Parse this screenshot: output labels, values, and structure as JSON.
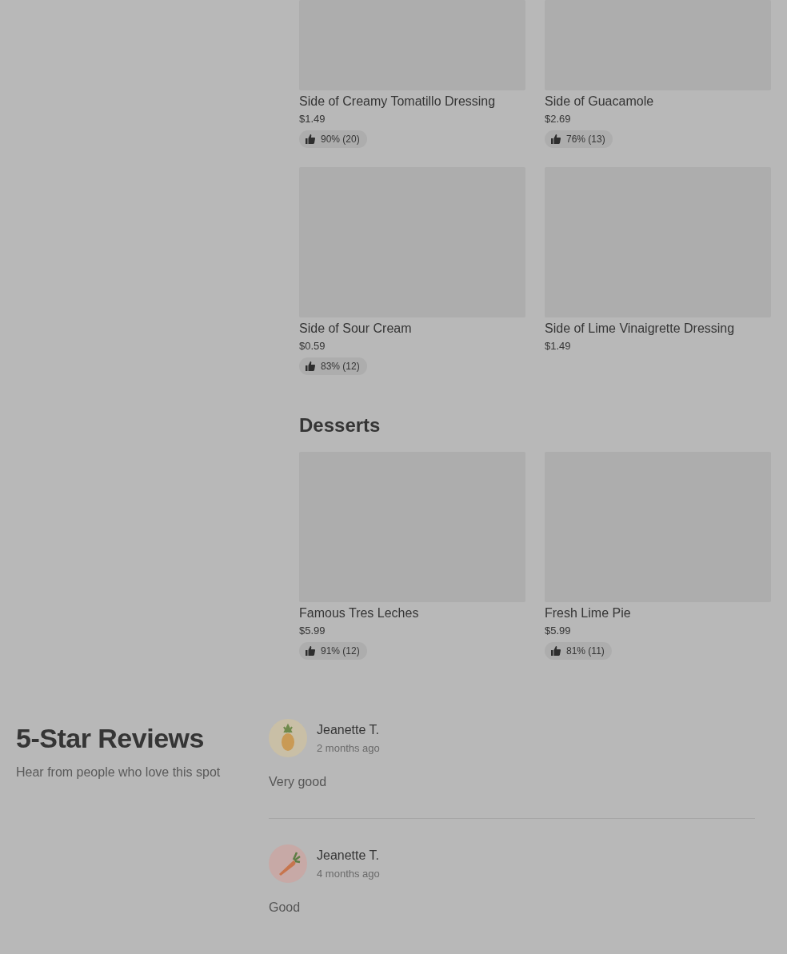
{
  "menu_sections": [
    {
      "items": [
        {
          "name": "Side of Creamy Tomatillo Dressing",
          "price": "$1.49",
          "rating": "90% (20)"
        },
        {
          "name": "Side of Guacamole",
          "price": "$2.69",
          "rating": "76% (13)"
        },
        {
          "name": "Side of Sour Cream",
          "price": "$0.59",
          "rating": "83% (12)"
        },
        {
          "name": "Side of Lime Vinaigrette Dressing",
          "price": "$1.49"
        }
      ]
    },
    {
      "title": "Desserts",
      "items": [
        {
          "name": "Famous Tres Leches",
          "price": "$5.99",
          "rating": "91% (12)"
        },
        {
          "name": "Fresh Lime Pie",
          "price": "$5.99",
          "rating": "81% (11)"
        }
      ]
    }
  ],
  "reviews_section": {
    "title": "5-Star Reviews",
    "subtitle": "Hear from people who love this spot",
    "reviews": [
      {
        "author": "Jeanette T.",
        "time": "2 months ago",
        "text": "Very good",
        "avatar": {
          "kind": "pineapple",
          "color": "#c9bfa6"
        }
      },
      {
        "author": "Jeanette T.",
        "time": "4 months ago",
        "text": "Good",
        "avatar": {
          "kind": "carrot",
          "color": "#c7a9a6"
        }
      }
    ]
  }
}
